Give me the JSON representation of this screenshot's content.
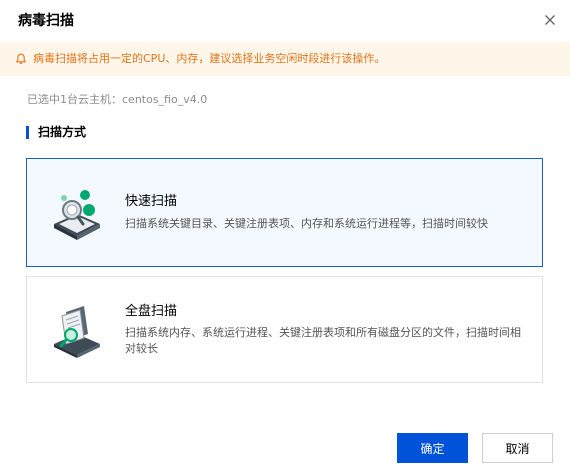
{
  "dialog": {
    "title": "病毒扫描",
    "close_icon": "close-icon"
  },
  "alert": {
    "icon": "bell-icon",
    "text": "病毒扫描将占用一定的CPU、内存，建议选择业务空闲时段进行该操作。"
  },
  "host": {
    "text": "已选中1台云主机：centos_fio_v4.0"
  },
  "section": {
    "title": "扫描方式"
  },
  "options": [
    {
      "title": "快速扫描",
      "desc": "扫描系统关键目录、关键注册表项、内存和系统运行进程等，扫描时间较快",
      "icon": "quick-scan-icon",
      "selected": true
    },
    {
      "title": "全盘扫描",
      "desc": "扫描系统内存、系统运行进程、关键注册表项和所有磁盘分区的文件，扫描时间相对较长",
      "icon": "full-scan-icon",
      "selected": false
    }
  ],
  "buttons": {
    "confirm": "确定",
    "cancel": "取消"
  },
  "colors": {
    "primary": "#0052d9",
    "warning_text": "#e37318",
    "warning_bg": "#fdf6e9",
    "selected_border": "#1a5fd0",
    "accent_green": "#00a870"
  }
}
